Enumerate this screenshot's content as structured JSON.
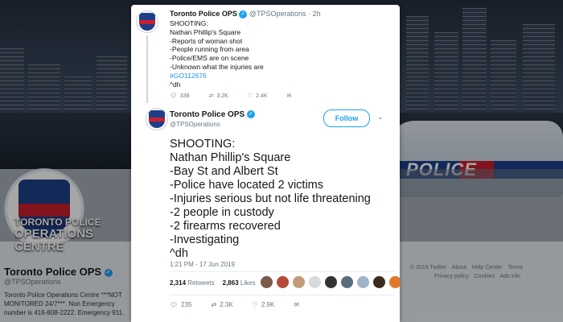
{
  "background": {
    "org_name_line1": "TORONTO POLICE",
    "org_name_line2": "OPERATIONS",
    "org_name_line3": "CENTRE",
    "car_label": "POLICE"
  },
  "profile": {
    "name": "Toronto Police OPS",
    "handle": "@TPSOperations",
    "bio": "Toronto Police Operations Centre ***NOT MONITORED 24/7***. Non Emergency number is 416-808-2222. Emergency 911."
  },
  "footer": {
    "links": [
      "© 2019 Twitter",
      "About",
      "Help Center",
      "Terms",
      "Privacy policy",
      "Cookies",
      "Ads info"
    ]
  },
  "thread_tweet": {
    "name": "Toronto Police OPS",
    "handle": "@TPSOperations",
    "age": "· 2h",
    "lines": [
      "SHOOTING:",
      "Nathan Phillip's Square",
      "-Reports of woman shot",
      "-People running from area",
      "-Police/EMS are on scene",
      "-Unknown what the injuries are"
    ],
    "hashtag": "#GO112676",
    "signature": "^dh",
    "replies": "338",
    "retweets": "3.2K",
    "likes": "2.4K"
  },
  "main_tweet": {
    "name": "Toronto Police OPS",
    "handle": "@TPSOperations",
    "follow_label": "Follow",
    "lines": [
      "SHOOTING:",
      "Nathan Phillip's Square",
      "-Bay St and Albert St",
      "-Police have located 2 victims",
      "-Injuries serious but not life threatening",
      "-2 people in custody",
      "-2 firearms recovered",
      "-Investigating",
      "^dh"
    ],
    "timestamp": "1:21 PM - 17 Jun 2019",
    "retweet_count": "2,314",
    "retweet_label": "Retweets",
    "like_count": "2,863",
    "like_label": "Likes",
    "replies": "235",
    "retweets": "2.3K",
    "likes": "2.9K"
  },
  "colors": {
    "twitter_blue": "#1da1f2",
    "police_blue": "#1e3f88",
    "police_red": "#c8202e"
  }
}
